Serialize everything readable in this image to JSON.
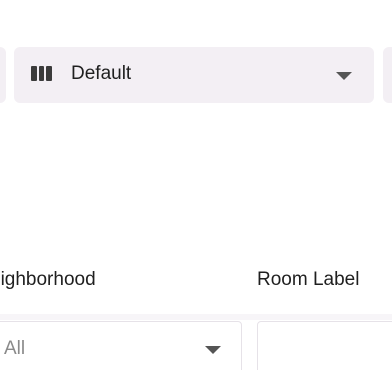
{
  "view_selector": {
    "selected": "Default",
    "icon": "view-columns-icon",
    "dropdown_icon": "caret-down-icon"
  },
  "filters": {
    "neighborhood": {
      "label": "eighborhood",
      "value": "All",
      "dropdown_icon": "caret-down-icon"
    },
    "room_label": {
      "label": "Room Label",
      "value": ""
    }
  },
  "colors": {
    "toolbar_background": "#f3eff4",
    "text_primary": "#1f1f1f",
    "text_muted": "#8a8a8a",
    "input_border": "#e6e2e8"
  }
}
